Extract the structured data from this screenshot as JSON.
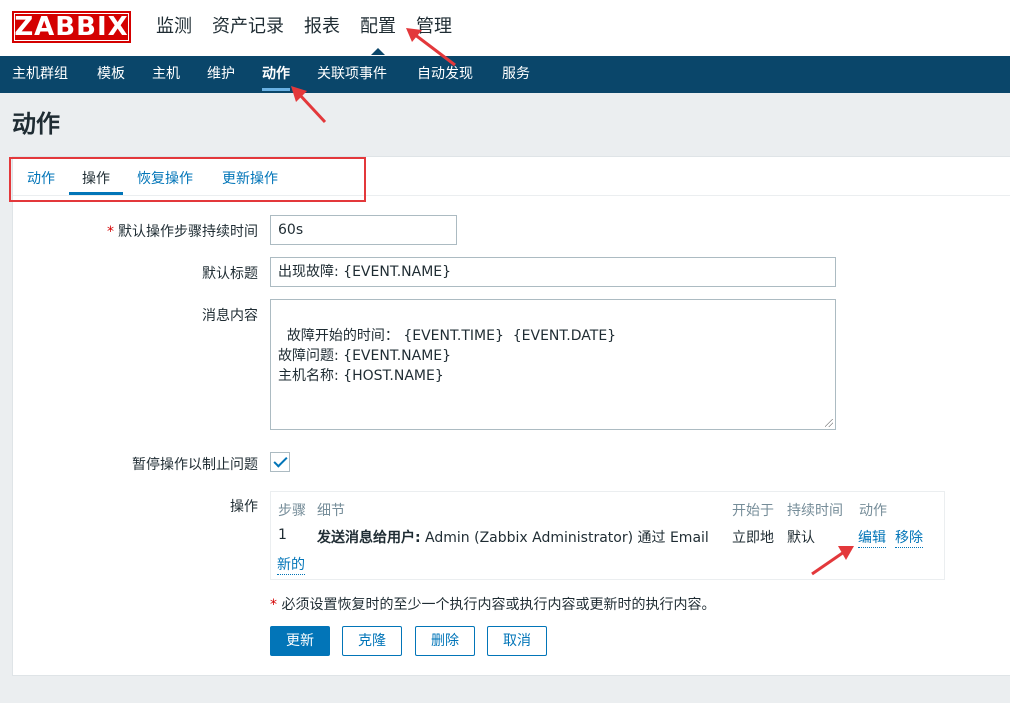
{
  "brand": {
    "logo_text": "ZABBIX",
    "color": "#d40000"
  },
  "main_nav": [
    "监测",
    "资产记录",
    "报表",
    "配置",
    "管理"
  ],
  "main_nav_selected": "配置",
  "sub_nav": [
    "主机群组",
    "模板",
    "主机",
    "维护",
    "动作",
    "关联项事件",
    "自动发现",
    "服务"
  ],
  "sub_nav_selected": "动作",
  "page_title": "动作",
  "tabs": [
    "动作",
    "操作",
    "恢复操作",
    "更新操作"
  ],
  "tab_selected": "操作",
  "form": {
    "step_duration": {
      "label": "默认操作步骤持续时间",
      "required": "*",
      "value": "60s"
    },
    "subject": {
      "label": "默认标题",
      "value": "出现故障: {EVENT.NAME}"
    },
    "message": {
      "label": "消息内容",
      "value": "故障开始的时间： {EVENT.TIME}  {EVENT.DATE}\n故障问题: {EVENT.NAME}\n主机名称: {HOST.NAME}"
    },
    "pause": {
      "label": "暂停操作以制止问题",
      "checked": true
    },
    "operations": {
      "label": "操作",
      "columns": [
        "步骤",
        "细节",
        "开始于",
        "持续时间",
        "动作"
      ],
      "rows": [
        {
          "step": "1",
          "detail_bold": "发送消息给用户:",
          "detail_rest": " Admin (Zabbix Administrator) 通过 Email",
          "start": "立即地",
          "duration": "默认",
          "edit": "编辑",
          "remove": "移除"
        }
      ],
      "new_link": "新的"
    },
    "note_required": "*",
    "note": " 必须设置恢复时的至少一个执行内容或执行内容或更新时的执行内容。"
  },
  "buttons": {
    "update": "更新",
    "clone": "克隆",
    "delete": "删除",
    "cancel": "取消"
  },
  "accent_color": "#0275b8",
  "header_color": "#0a466a",
  "annotation_color": "#e3383b"
}
